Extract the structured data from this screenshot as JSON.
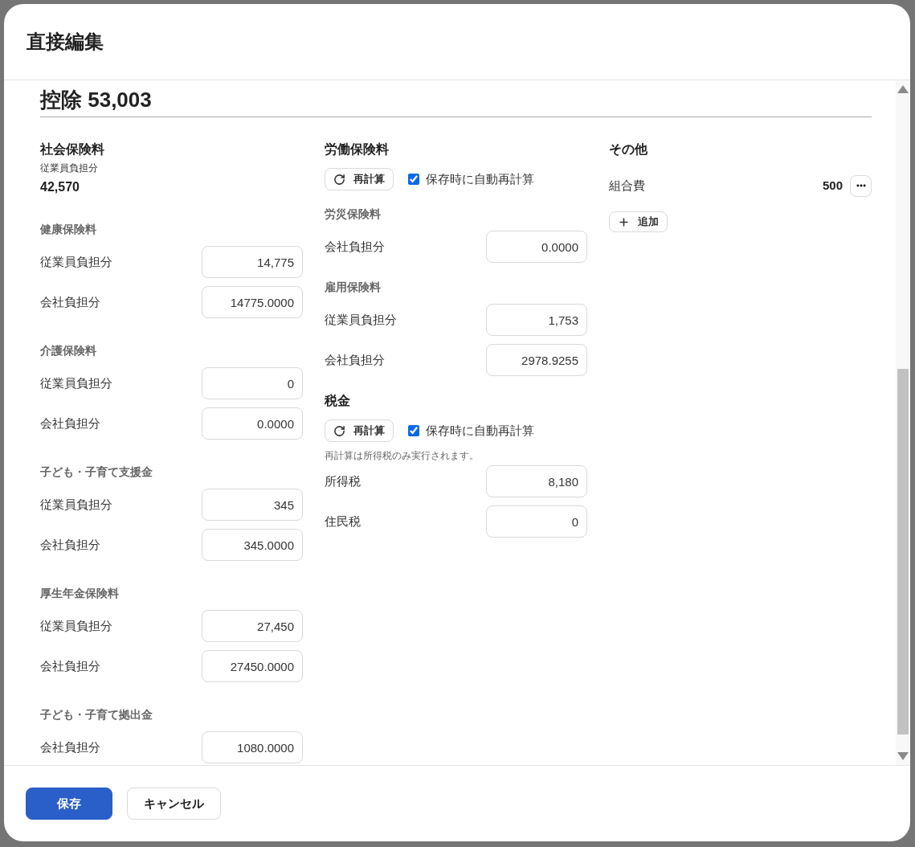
{
  "dialog": {
    "title": "直接編集"
  },
  "deduction": {
    "heading": "控除 53,003"
  },
  "social_insurance": {
    "title": "社会保険料",
    "summary_label": "従業員負担分",
    "summary_value": "42,570",
    "groups": [
      {
        "title": "健康保険料",
        "rows": [
          {
            "label": "従業員負担分",
            "value": "14,775"
          },
          {
            "label": "会社負担分",
            "value": "14775.0000"
          }
        ]
      },
      {
        "title": "介護保険料",
        "rows": [
          {
            "label": "従業員負担分",
            "value": "0"
          },
          {
            "label": "会社負担分",
            "value": "0.0000"
          }
        ]
      },
      {
        "title": "子ども・子育て支援金",
        "rows": [
          {
            "label": "従業員負担分",
            "value": "345"
          },
          {
            "label": "会社負担分",
            "value": "345.0000"
          }
        ]
      },
      {
        "title": "厚生年金保険料",
        "rows": [
          {
            "label": "従業員負担分",
            "value": "27,450"
          },
          {
            "label": "会社負担分",
            "value": "27450.0000"
          }
        ]
      },
      {
        "title": "子ども・子育て拠出金",
        "rows": [
          {
            "label": "会社負担分",
            "value": "1080.0000"
          }
        ]
      }
    ]
  },
  "labor_insurance": {
    "title": "労働保険料",
    "recalc_button": "再計算",
    "auto_recalc": {
      "label": "保存時に自動再計算",
      "checked": true
    },
    "groups": [
      {
        "title": "労災保険料",
        "rows": [
          {
            "label": "会社負担分",
            "value": "0.0000"
          }
        ]
      },
      {
        "title": "雇用保険料",
        "rows": [
          {
            "label": "従業員負担分",
            "value": "1,753"
          },
          {
            "label": "会社負担分",
            "value": "2978.9255"
          }
        ]
      }
    ]
  },
  "tax": {
    "title": "税金",
    "recalc_button": "再計算",
    "auto_recalc": {
      "label": "保存時に自動再計算",
      "checked": true
    },
    "note": "再計算は所得税のみ実行されます。",
    "rows": [
      {
        "label": "所得税",
        "value": "8,180"
      },
      {
        "label": "住民税",
        "value": "0"
      }
    ]
  },
  "other": {
    "title": "その他",
    "items": [
      {
        "label": "組合費",
        "value": "500"
      }
    ],
    "add_button": "追加"
  },
  "footer": {
    "buttons": [
      {
        "label": "保存",
        "kind": "primary"
      },
      {
        "label": "キャンセル",
        "kind": "secondary"
      }
    ]
  }
}
